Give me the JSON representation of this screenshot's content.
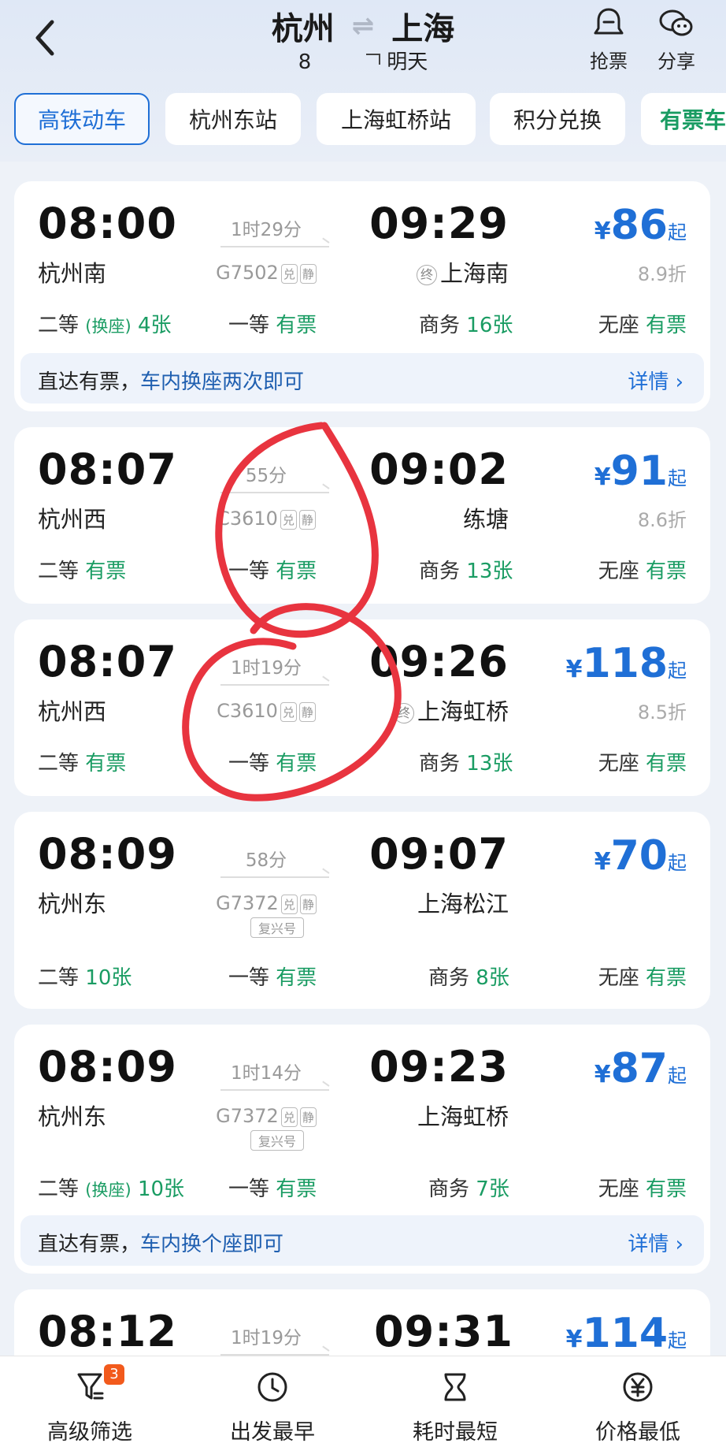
{
  "header": {
    "from": "杭州",
    "to": "上海",
    "date_month": "8",
    "date_label": "明天",
    "actions": [
      {
        "label": "抢票",
        "icon": "ticket-bell-icon"
      },
      {
        "label": "分享",
        "icon": "wechat-share-icon"
      }
    ]
  },
  "tabs": [
    "高铁动车",
    "杭州东站",
    "上海虹桥站",
    "积分兑换",
    "有票车"
  ],
  "trains": [
    {
      "dep_time": "08:00",
      "dep_station": "杭州南",
      "duration": "1时29分",
      "train_no": "G7502",
      "tags": [
        "兑",
        "静"
      ],
      "fuxing": "",
      "arr_time": "09:29",
      "arr_station": "上海南",
      "arr_terminal": "终",
      "price_yen": "¥",
      "price": "86",
      "price_suffix": "起",
      "discount": "8.9折",
      "seats": [
        {
          "cls": "二等",
          "hz": "(换座)",
          "val": "4张"
        },
        {
          "cls": "一等",
          "hz": "",
          "val": "有票"
        },
        {
          "cls": "商务",
          "hz": "",
          "val": "16张"
        },
        {
          "cls": "无座",
          "hz": "",
          "val": "有票"
        }
      ],
      "tip": {
        "prefix": "直达有票，",
        "highlight": "车内换座两次即可",
        "detail": "详情 ›"
      }
    },
    {
      "dep_time": "08:07",
      "dep_station": "杭州西",
      "duration": "55分",
      "train_no": "C3610",
      "tags": [
        "兑",
        "静"
      ],
      "fuxing": "",
      "arr_time": "09:02",
      "arr_station": "练塘",
      "arr_terminal": "",
      "price_yen": "¥",
      "price": "91",
      "price_suffix": "起",
      "discount": "8.6折",
      "seats": [
        {
          "cls": "二等",
          "hz": "",
          "val": "有票"
        },
        {
          "cls": "一等",
          "hz": "",
          "val": "有票"
        },
        {
          "cls": "商务",
          "hz": "",
          "val": "13张"
        },
        {
          "cls": "无座",
          "hz": "",
          "val": "有票"
        }
      ]
    },
    {
      "dep_time": "08:07",
      "dep_station": "杭州西",
      "duration": "1时19分",
      "train_no": "C3610",
      "tags": [
        "兑",
        "静"
      ],
      "fuxing": "",
      "arr_time": "09:26",
      "arr_station": "上海虹桥",
      "arr_terminal": "终",
      "price_yen": "¥",
      "price": "118",
      "price_suffix": "起",
      "discount": "8.5折",
      "seats": [
        {
          "cls": "二等",
          "hz": "",
          "val": "有票"
        },
        {
          "cls": "一等",
          "hz": "",
          "val": "有票"
        },
        {
          "cls": "商务",
          "hz": "",
          "val": "13张"
        },
        {
          "cls": "无座",
          "hz": "",
          "val": "有票"
        }
      ]
    },
    {
      "dep_time": "08:09",
      "dep_station": "杭州东",
      "duration": "58分",
      "train_no": "G7372",
      "tags": [
        "兑",
        "静"
      ],
      "fuxing": "复兴号",
      "arr_time": "09:07",
      "arr_station": "上海松江",
      "arr_terminal": "",
      "price_yen": "¥",
      "price": "70",
      "price_suffix": "起",
      "discount": "",
      "seats": [
        {
          "cls": "二等",
          "hz": "",
          "val": "10张"
        },
        {
          "cls": "一等",
          "hz": "",
          "val": "有票"
        },
        {
          "cls": "商务",
          "hz": "",
          "val": "8张"
        },
        {
          "cls": "无座",
          "hz": "",
          "val": "有票"
        }
      ]
    },
    {
      "dep_time": "08:09",
      "dep_station": "杭州东",
      "duration": "1时14分",
      "train_no": "G7372",
      "tags": [
        "兑",
        "静"
      ],
      "fuxing": "复兴号",
      "arr_time": "09:23",
      "arr_station": "上海虹桥",
      "arr_terminal": "",
      "price_yen": "¥",
      "price": "87",
      "price_suffix": "起",
      "discount": "",
      "seats": [
        {
          "cls": "二等",
          "hz": "(换座)",
          "val": "10张"
        },
        {
          "cls": "一等",
          "hz": "",
          "val": "有票"
        },
        {
          "cls": "商务",
          "hz": "",
          "val": "7张"
        },
        {
          "cls": "无座",
          "hz": "",
          "val": "有票"
        }
      ],
      "tip": {
        "prefix": "直达有票，",
        "highlight": "车内换个座即可",
        "detail": "详情 ›"
      }
    },
    {
      "dep_time": "08:12",
      "dep_station": "",
      "duration": "1时19分",
      "train_no": "",
      "tags": [],
      "fuxing": "",
      "arr_time": "09:31",
      "arr_station": "",
      "arr_terminal": "",
      "price_yen": "¥",
      "price": "114",
      "price_suffix": "起",
      "discount": ""
    }
  ],
  "bottom_bar": [
    {
      "label": "高级筛选",
      "icon": "filter-icon",
      "badge": "3"
    },
    {
      "label": "出发最早",
      "icon": "clock-icon"
    },
    {
      "label": "耗时最短",
      "icon": "hourglass-icon"
    },
    {
      "label": "价格最低",
      "icon": "yen-circle-icon"
    }
  ],
  "colors": {
    "accent": "#1f6fd6",
    "available": "#1a9c63",
    "annotation": "#e8343f"
  }
}
